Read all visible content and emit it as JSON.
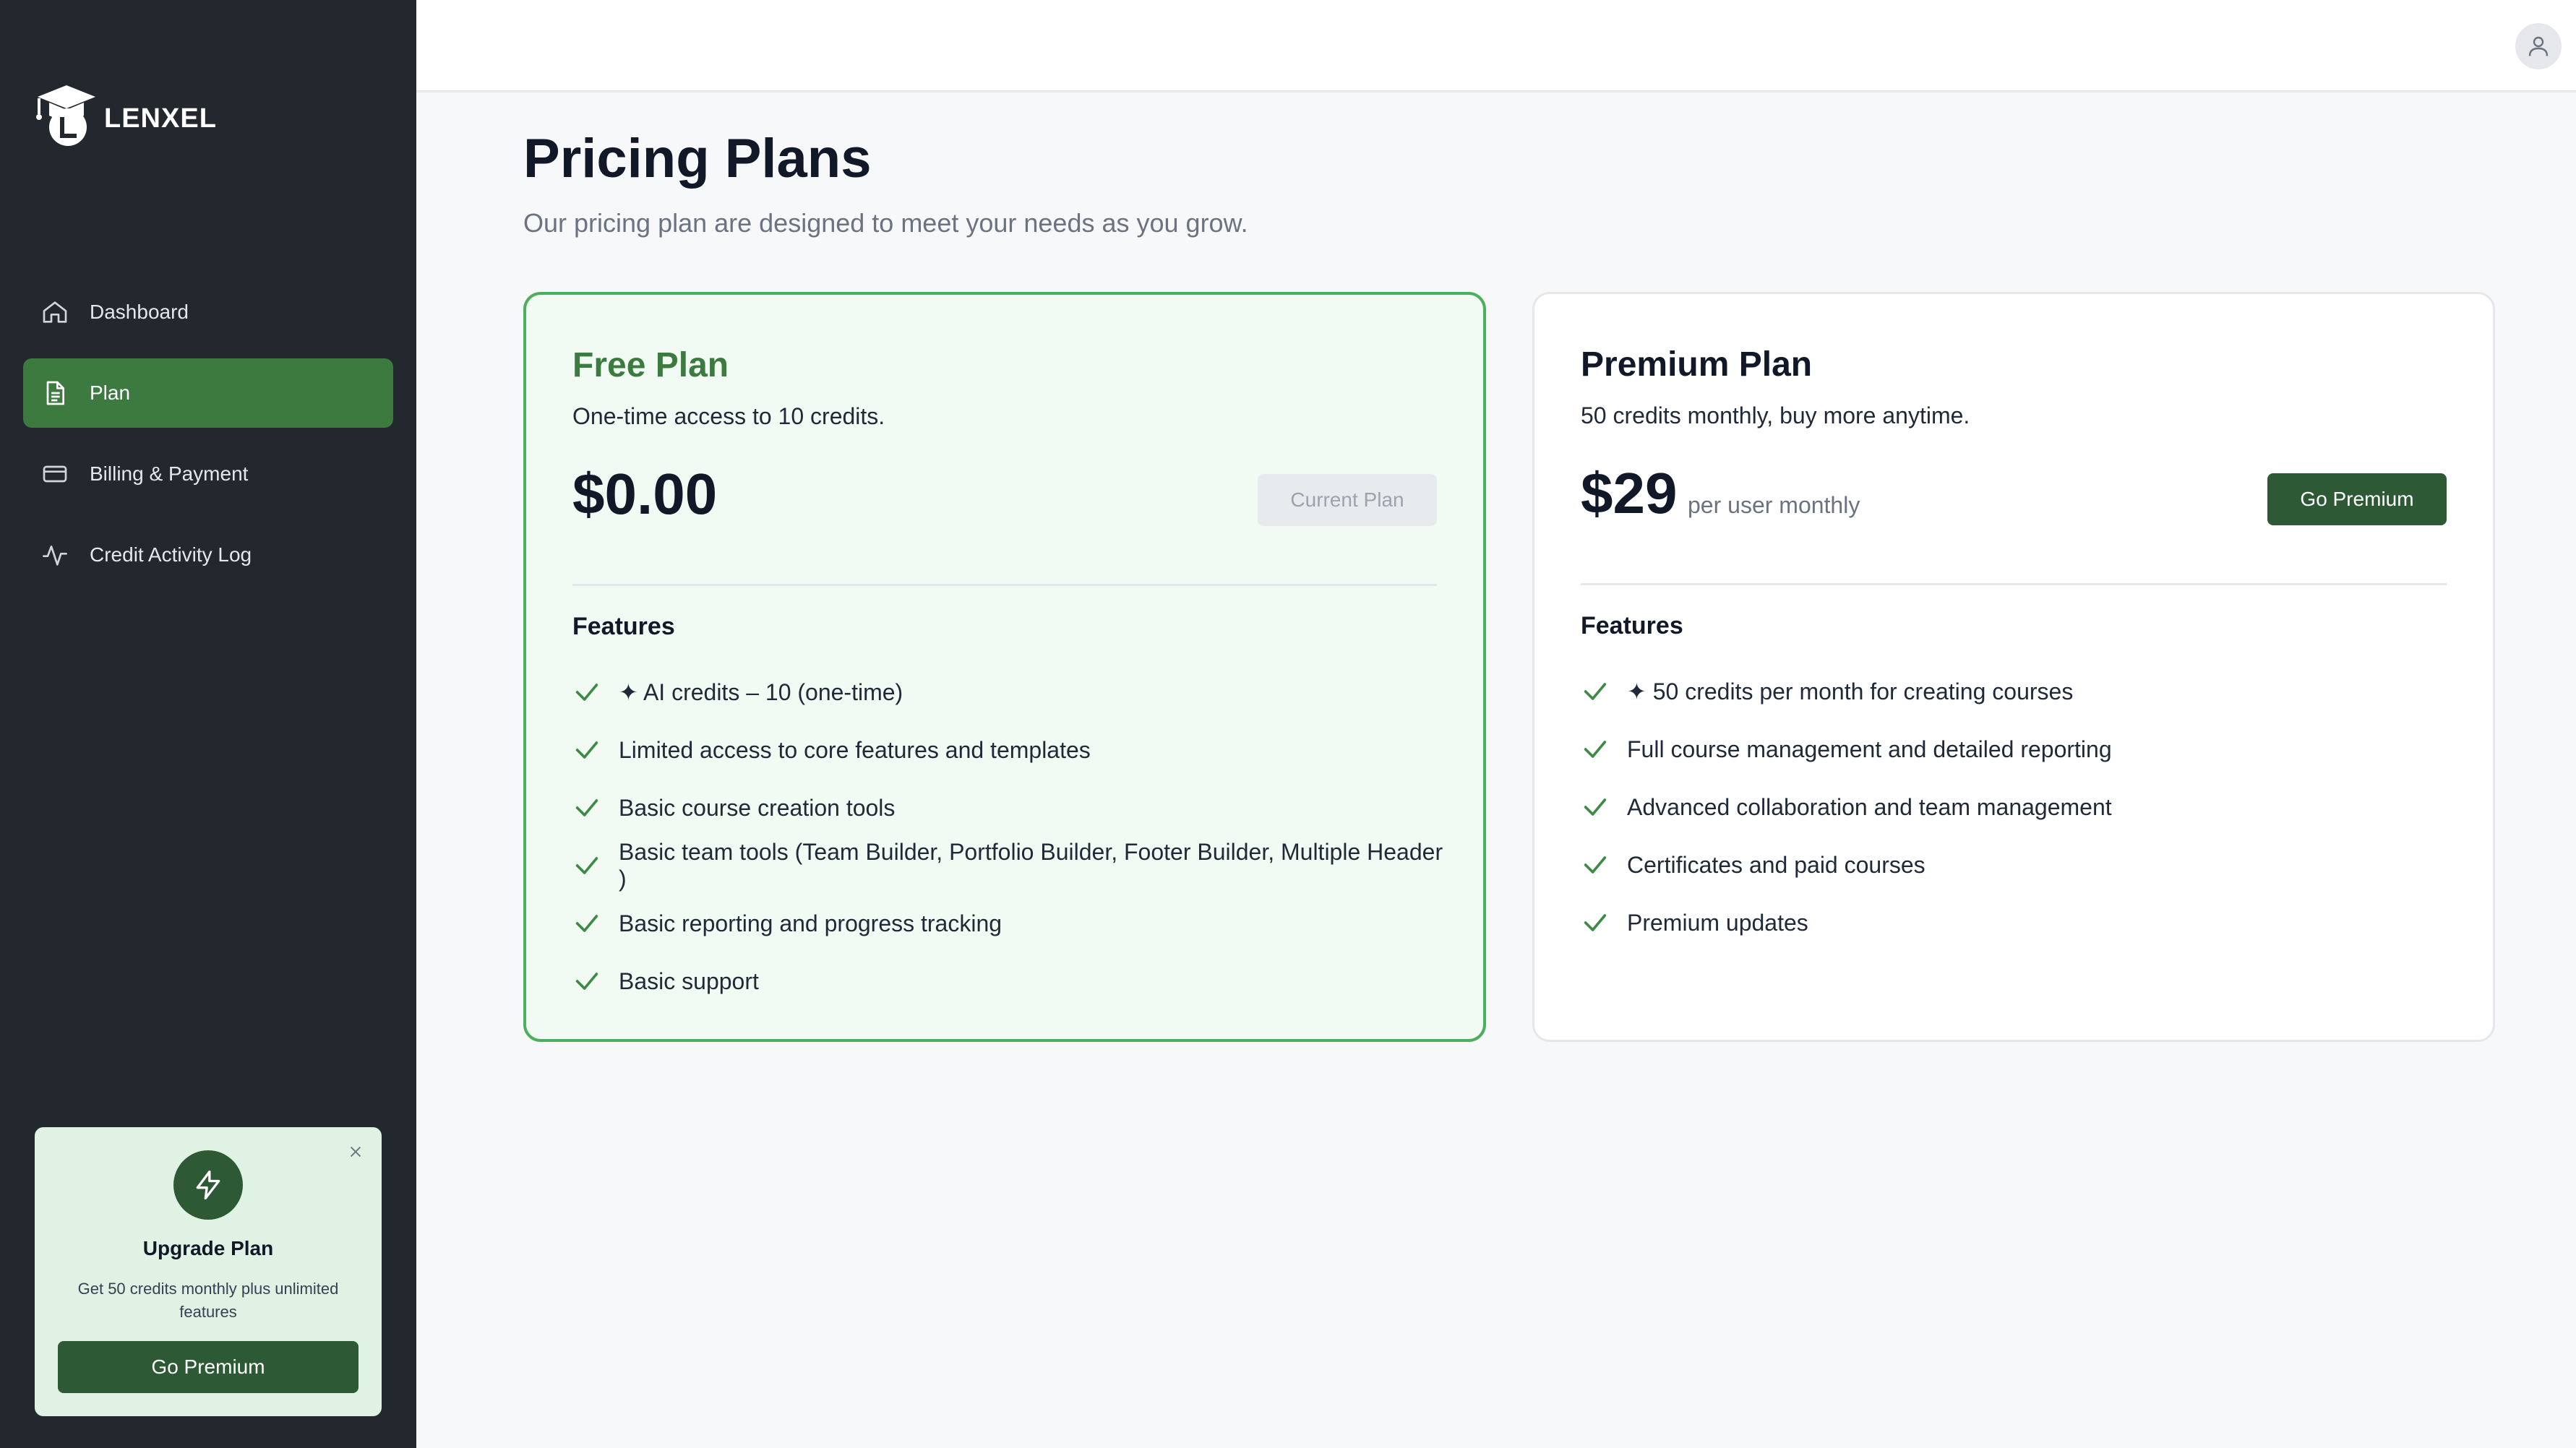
{
  "brand": {
    "name": "LENXEL"
  },
  "sidebar": {
    "items": [
      {
        "label": "Dashboard",
        "icon": "home-icon",
        "active": false
      },
      {
        "label": "Plan",
        "icon": "document-icon",
        "active": true
      },
      {
        "label": "Billing & Payment",
        "icon": "credit-card-icon",
        "active": false
      },
      {
        "label": "Credit Activity Log",
        "icon": "activity-icon",
        "active": false
      }
    ],
    "upgrade": {
      "title": "Upgrade Plan",
      "description": "Get 50 credits monthly plus unlimited features",
      "button_label": "Go Premium"
    }
  },
  "page": {
    "title": "Pricing Plans",
    "subtitle": "Our pricing plan are designed to meet your needs as you grow."
  },
  "plans": [
    {
      "name": "Free Plan",
      "description": "One-time access to 10 credits.",
      "price": "$0.00",
      "price_note": "",
      "button_label": "Current Plan",
      "features_title": "Features",
      "features": [
        "✦ AI credits – 10 (one-time)",
        "Limited access to core features and templates",
        "Basic course creation tools",
        "Basic team tools (Team Builder, Portfolio Builder, Footer Builder, Multiple Header )",
        "Basic reporting and progress tracking",
        "Basic support"
      ]
    },
    {
      "name": "Premium Plan",
      "description": "50 credits monthly, buy more anytime.",
      "price": "$29",
      "price_note": "per user monthly",
      "button_label": "Go Premium",
      "features_title": "Features",
      "features": [
        "✦ 50 credits per month for creating courses",
        "Full course management and detailed reporting",
        "Advanced collaboration and team management",
        "Certificates and paid courses",
        "Premium updates"
      ]
    }
  ],
  "colors": {
    "sidebar_bg": "#23282e",
    "accent_green": "#3c7a40",
    "dark_green": "#2d5a35",
    "free_card_bg": "#f1faf3"
  }
}
